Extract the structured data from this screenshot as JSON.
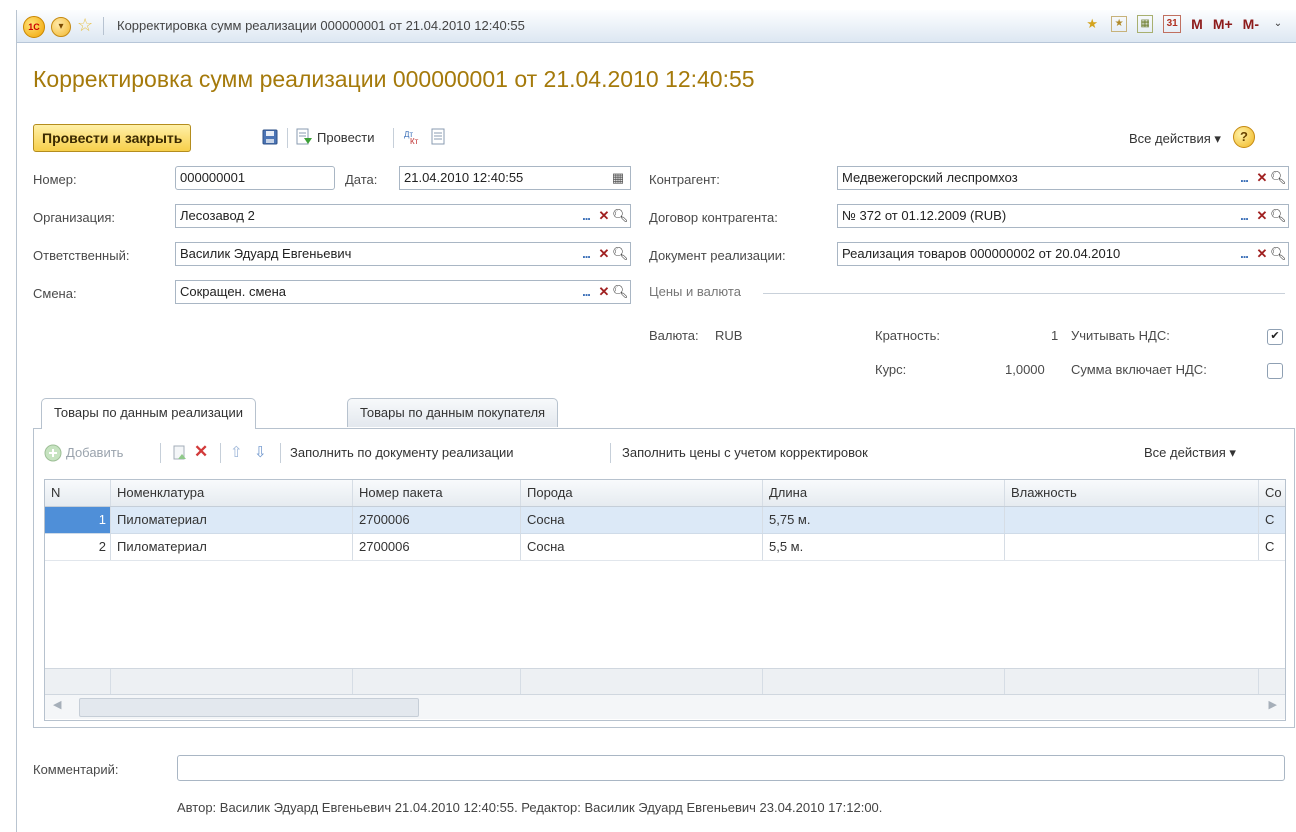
{
  "window": {
    "title": "Корректировка сумм реализации 000000001 от 21.04.2010 12:40:55",
    "m_labels": [
      "M",
      "M+",
      "M-"
    ]
  },
  "document": {
    "title": "Корректировка сумм реализации 000000001 от 21.04.2010 12:40:55"
  },
  "toolbar": {
    "post_close_label": "Провести и закрыть",
    "post_label": "Провести",
    "all_actions_label": "Все действия ▾",
    "help_symbol": "?"
  },
  "form": {
    "number_label": "Номер:",
    "number_value": "000000001",
    "date_label": "Дата:",
    "date_value": "21.04.2010 12:40:55",
    "org_label": "Организация:",
    "org_value": "Лесозавод 2",
    "resp_label": "Ответственный:",
    "resp_value": "Василик Эдуард Евгеньевич",
    "shift_label": "Смена:",
    "shift_value": "Сокращен. смена",
    "contractor_label": "Контрагент:",
    "contractor_value": "Медвежегорский леспромхоз",
    "contract_label": "Договор контрагента:",
    "contract_value": "№ 372 от 01.12.2009 (RUB)",
    "sale_doc_label": "Документ реализации:",
    "sale_doc_value": "Реализация товаров 000000002 от 20.04.2010",
    "prices_section": "Цены и валюта",
    "currency_label": "Валюта:",
    "currency_value": "RUB",
    "multiplicity_label": "Кратность:",
    "multiplicity_value": "1",
    "vat_label": "Учитывать НДС:",
    "vat_checked": true,
    "rate_label": "Курс:",
    "rate_value": "1,0000",
    "sum_includes_vat_label": "Сумма включает НДС:",
    "sum_includes_vat_checked": false
  },
  "tabs": [
    {
      "label": "Товары по данным реализации",
      "active": true
    },
    {
      "label": "Товары по данным покупателя",
      "active": false
    }
  ],
  "table_toolbar": {
    "add_label": "Добавить",
    "fill_by_doc_label": "Заполнить по документу реализации",
    "fill_prices_label": "Заполнить цены с учетом корректировок",
    "all_actions_label": "Все действия ▾"
  },
  "table": {
    "columns": [
      "N",
      "Номенклатура",
      "Номер пакета",
      "Порода",
      "Длина",
      "Влажность",
      "Со"
    ],
    "rows": [
      [
        "1",
        "Пиломатериал",
        "2700006",
        "Сосна",
        "5,75 м.",
        "",
        "С"
      ],
      [
        "2",
        "Пиломатериал",
        "2700006",
        "Сосна",
        "5,5 м.",
        "",
        "С"
      ]
    ]
  },
  "comment": {
    "label": "Комментарий:",
    "value": ""
  },
  "footer": {
    "text": "Автор: Василик Эдуард Евгеньевич 21.04.2010 12:40:55. Редактор: Василик Эдуард Евгеньевич 23.04.2010 17:12:00."
  }
}
